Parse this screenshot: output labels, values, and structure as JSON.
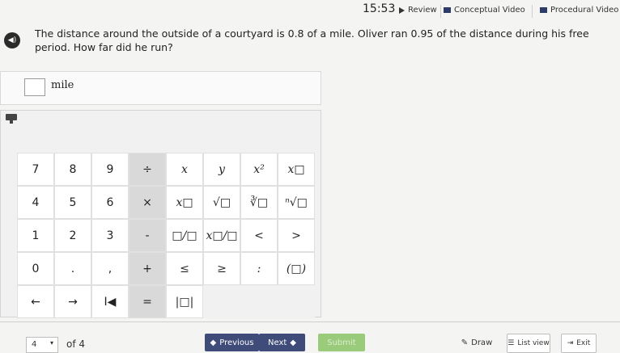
{
  "topbar": {
    "time": "15:53",
    "review": "Review",
    "conceptual_video": "Conceptual Video",
    "procedural_video": "Procedural Video"
  },
  "question": {
    "text": "The distance around the outside of a courtyard is 0.8 of a mile. Oliver ran 0.95 of the distance during his free period. How far did he run?"
  },
  "answer": {
    "value": "",
    "unit": "mile"
  },
  "keypad": {
    "keys": [
      [
        "7",
        "8",
        "9",
        "÷",
        "x",
        "y",
        "x²",
        "x□"
      ],
      [
        "4",
        "5",
        "6",
        "×",
        "x□",
        "√□",
        "∛□",
        "ⁿ√□"
      ],
      [
        "1",
        "2",
        "3",
        "-",
        "□/□",
        "x□/□",
        "<",
        ">"
      ],
      [
        "0",
        ".",
        ",",
        "+",
        "≤",
        "≥",
        ":",
        "(□)"
      ],
      [
        "←",
        "→",
        "I◀",
        "=",
        "|□|",
        "",
        "",
        ""
      ]
    ]
  },
  "footer": {
    "page": "4",
    "of_total": "of 4",
    "previous": "Previous",
    "next": "Next",
    "submit": "Submit",
    "draw": "Draw",
    "list_view": "List view",
    "exit": "Exit"
  }
}
